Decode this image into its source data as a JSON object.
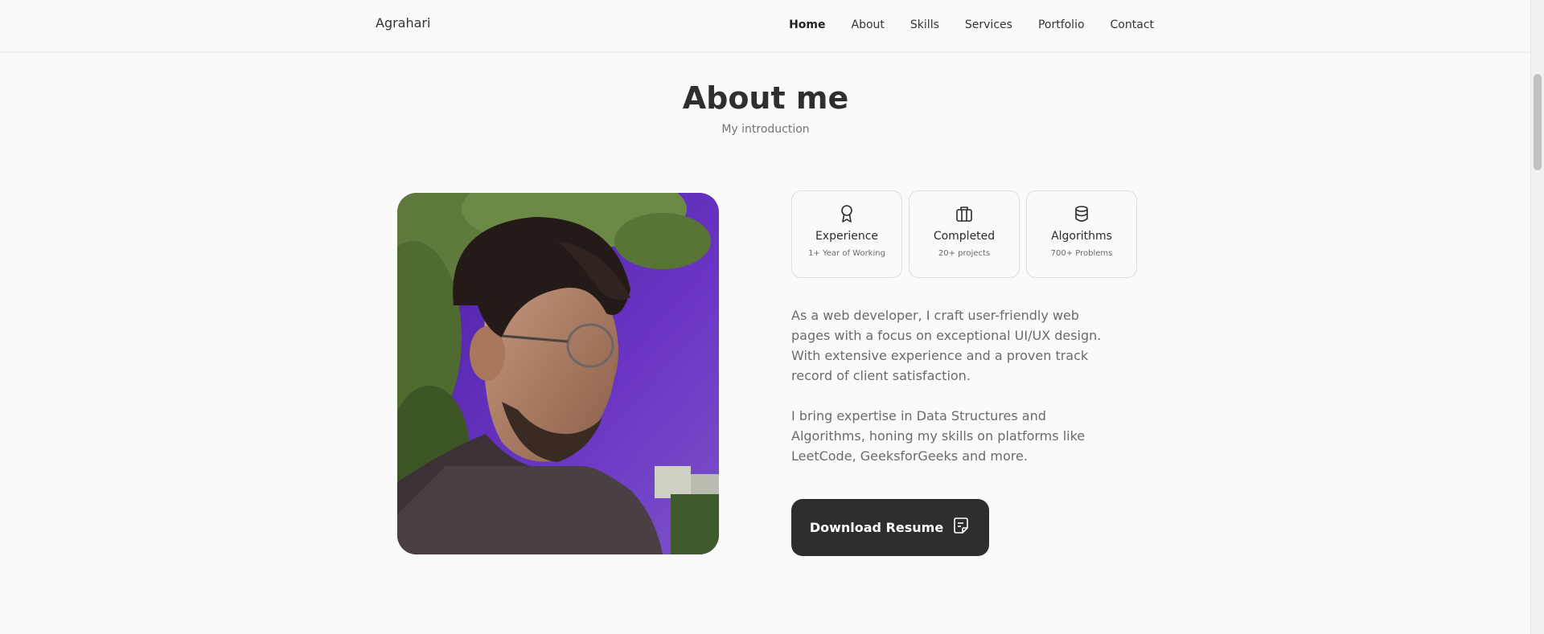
{
  "header": {
    "logo": "Agrahari",
    "nav": [
      {
        "label": "Home",
        "active": true
      },
      {
        "label": "About"
      },
      {
        "label": "Skills"
      },
      {
        "label": "Services"
      },
      {
        "label": "Portfolio"
      },
      {
        "label": "Contact"
      }
    ]
  },
  "about": {
    "title": "About me",
    "subtitle": "My introduction",
    "photo": {
      "subject": "portrait"
    },
    "cards": [
      {
        "icon": "award-icon",
        "title": "Experience",
        "subtitle": "1+ Year of Working"
      },
      {
        "icon": "briefcase-icon",
        "title": "Completed",
        "subtitle": "20+ projects"
      },
      {
        "icon": "database-icon",
        "title": "Algorithms",
        "subtitle": "700+ Problems"
      }
    ],
    "description": [
      "As a web developer, I craft user-friendly web pages with a focus on exceptional UI/UX design. With extensive experience and a proven track record of client satisfaction.",
      "I bring expertise in Data Structures and Algorithms, honing my skills on platforms like LeetCode, GeeksforGeeks and more."
    ],
    "download_label": "Download Resume",
    "download_icon": "document-icon"
  },
  "colors": {
    "background": "#fafafa",
    "button": "#2e2e2e",
    "photo_sky": "#5b2ab0"
  }
}
